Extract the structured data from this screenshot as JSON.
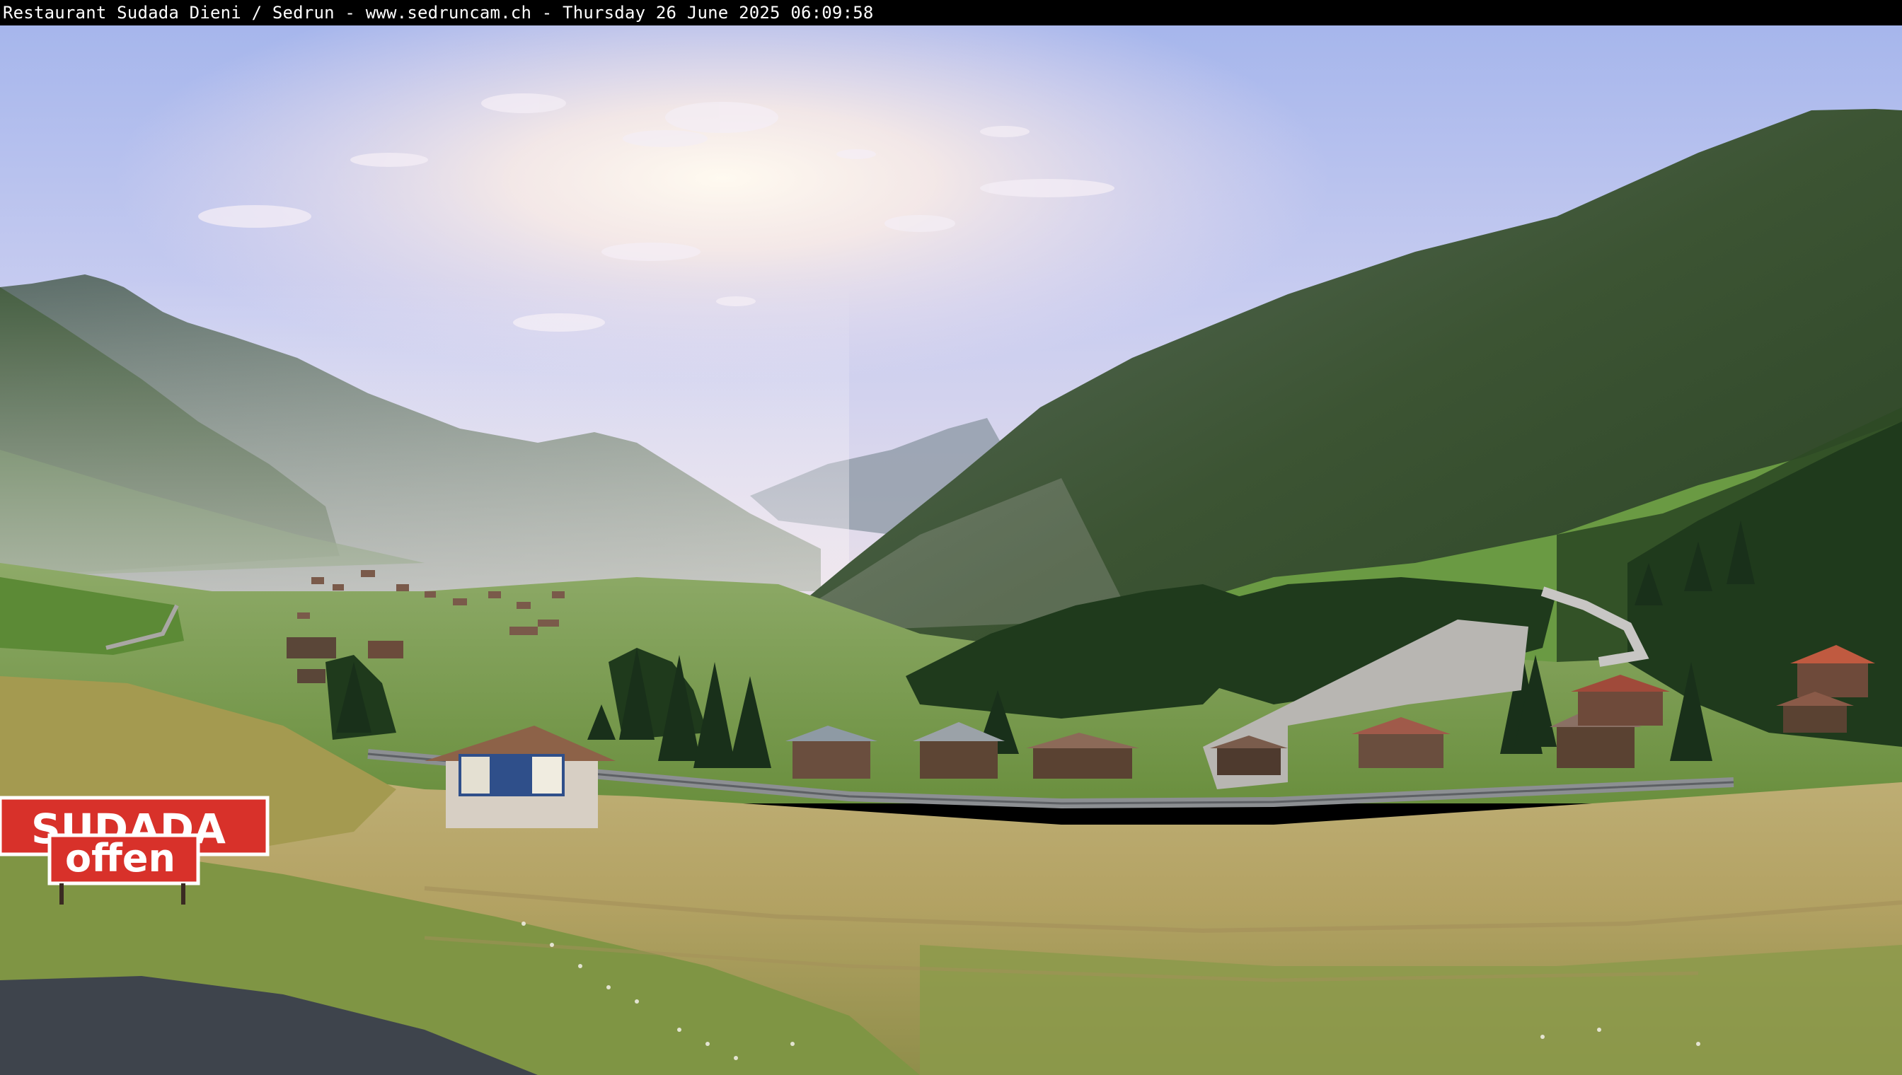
{
  "webcam": {
    "caption": "Restaurant Sudada Dieni / Sedrun - www.sedruncam.ch - Thursday 26 June 2025 06:09:58"
  },
  "signs": {
    "top_label": "SUDADA",
    "bottom_label": "offen"
  },
  "colors": {
    "sky_top": "#a9b9ec",
    "sun_glow": "#fff6e8",
    "mountain_right": "#2f4a2a",
    "meadow": "#b9a868",
    "sign_red": "#d8312a",
    "caption_bg": "#000000"
  }
}
